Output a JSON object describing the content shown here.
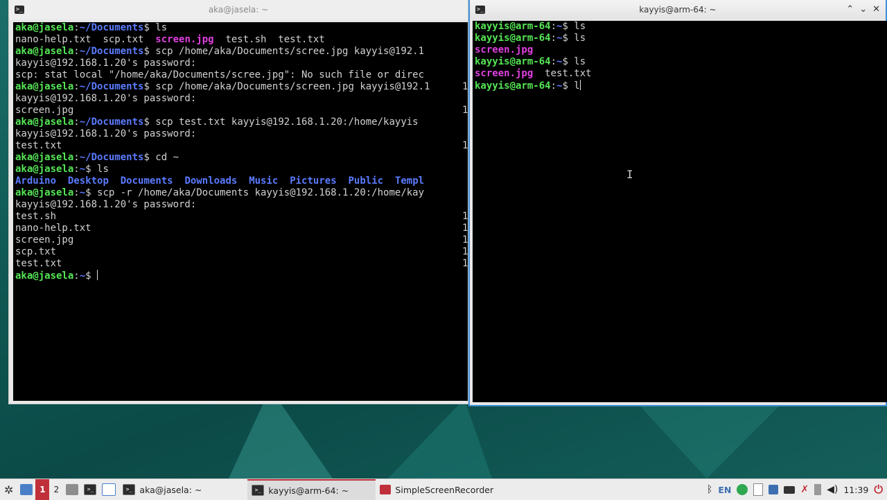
{
  "window_left": {
    "title": "aka@jasela: ~",
    "lines": [
      [
        {
          "t": "aka@jasela",
          "c": "p"
        },
        {
          "t": ":"
        },
        {
          "t": "~/Documents",
          "c": "d"
        },
        {
          "t": "$ ls"
        }
      ],
      [
        {
          "t": "nano-help.txt  scp.txt  "
        },
        {
          "t": "screen.jpg",
          "c": "m"
        },
        {
          "t": "  test.sh  test.txt"
        }
      ],
      [
        {
          "t": "aka@jasela",
          "c": "p"
        },
        {
          "t": ":"
        },
        {
          "t": "~/Documents",
          "c": "d"
        },
        {
          "t": "$ scp /home/aka/Documents/scree.jpg kayyis@192.1"
        }
      ],
      [
        {
          "t": "kayyis@192.168.1.20's password:"
        }
      ],
      [
        {
          "t": "scp: stat local \"/home/aka/Documents/scree.jpg\": No such file or direc"
        }
      ],
      [
        {
          "t": "aka@jasela",
          "c": "p"
        },
        {
          "t": ":"
        },
        {
          "t": "~/Documents",
          "c": "d"
        },
        {
          "t": "$ scp /home/aka/Documents/screen.jpg kayyis@192.1"
        }
      ],
      [
        {
          "t": "kayyis@192.168.1.20's password:"
        }
      ],
      [
        {
          "t": "screen.jpg"
        }
      ],
      [
        {
          "t": "aka@jasela",
          "c": "p"
        },
        {
          "t": ":"
        },
        {
          "t": "~/Documents",
          "c": "d"
        },
        {
          "t": "$ scp test.txt kayyis@192.168.1.20:/home/kayyis"
        }
      ],
      [
        {
          "t": "kayyis@192.168.1.20's password:"
        }
      ],
      [
        {
          "t": "test.txt"
        }
      ],
      [
        {
          "t": "aka@jasela",
          "c": "p"
        },
        {
          "t": ":"
        },
        {
          "t": "~/Documents",
          "c": "d"
        },
        {
          "t": "$ cd ~"
        }
      ],
      [
        {
          "t": "aka@jasela",
          "c": "p"
        },
        {
          "t": ":"
        },
        {
          "t": "~",
          "c": "d"
        },
        {
          "t": "$ ls"
        }
      ],
      [
        {
          "t": "Arduino",
          "c": "d"
        },
        {
          "t": "  "
        },
        {
          "t": "Desktop",
          "c": "d"
        },
        {
          "t": "  "
        },
        {
          "t": "Documents",
          "c": "d"
        },
        {
          "t": "  "
        },
        {
          "t": "Downloads",
          "c": "d"
        },
        {
          "t": "  "
        },
        {
          "t": "Music",
          "c": "d"
        },
        {
          "t": "  "
        },
        {
          "t": "Pictures",
          "c": "d"
        },
        {
          "t": "  "
        },
        {
          "t": "Public",
          "c": "d"
        },
        {
          "t": "  "
        },
        {
          "t": "Templ",
          "c": "d"
        }
      ],
      [
        {
          "t": "aka@jasela",
          "c": "p"
        },
        {
          "t": ":"
        },
        {
          "t": "~",
          "c": "d"
        },
        {
          "t": "$ scp -r /home/aka/Documents kayyis@192.168.1.20:/home/kay"
        }
      ],
      [
        {
          "t": "kayyis@192.168.1.20's password:"
        }
      ],
      [
        {
          "t": "test.sh"
        }
      ],
      [
        {
          "t": "nano-help.txt"
        }
      ],
      [
        {
          "t": "screen.jpg"
        }
      ],
      [
        {
          "t": "scp.txt"
        }
      ],
      [
        {
          "t": "test.txt"
        }
      ],
      [
        {
          "t": "aka@jasela",
          "c": "p"
        },
        {
          "t": ":"
        },
        {
          "t": "~",
          "c": "d"
        },
        {
          "t": "$ "
        },
        {
          "cursor": true
        }
      ]
    ],
    "clipped_edge": [
      "1",
      "1",
      "1",
      "1",
      "1",
      "1",
      "1",
      "1",
      "1"
    ]
  },
  "window_right": {
    "title": "kayyis@arm-64: ~",
    "lines": [
      [
        {
          "t": "kayyis@arm-64",
          "c": "p"
        },
        {
          "t": ":"
        },
        {
          "t": "~",
          "c": "d"
        },
        {
          "t": "$ ls"
        }
      ],
      [
        {
          "t": "kayyis@arm-64",
          "c": "p"
        },
        {
          "t": ":"
        },
        {
          "t": "~",
          "c": "d"
        },
        {
          "t": "$ ls"
        }
      ],
      [
        {
          "t": "screen.jpg",
          "c": "m"
        }
      ],
      [
        {
          "t": "kayyis@arm-64",
          "c": "p"
        },
        {
          "t": ":"
        },
        {
          "t": "~",
          "c": "d"
        },
        {
          "t": "$ ls"
        }
      ],
      [
        {
          "t": "screen.jpg",
          "c": "m"
        },
        {
          "t": "  test.txt"
        }
      ],
      [
        {
          "t": "kayyis@arm-64",
          "c": "p"
        },
        {
          "t": ":"
        },
        {
          "t": "~",
          "c": "d"
        },
        {
          "t": "$ l"
        },
        {
          "cursor": true
        }
      ]
    ]
  },
  "taskbar": {
    "workspaces": [
      "1",
      "2"
    ],
    "tasks": [
      "aka@jasela: ~",
      "kayyis@arm-64: ~",
      "SimpleScreenRecorder"
    ],
    "keyboard_layout": "EN",
    "clock": "11:39"
  },
  "colors": {
    "prompt": "#55e655",
    "dir": "#5b7bff",
    "image": "#e040e0",
    "accent": "#c0303a",
    "active_border": "#3d8fd6"
  }
}
